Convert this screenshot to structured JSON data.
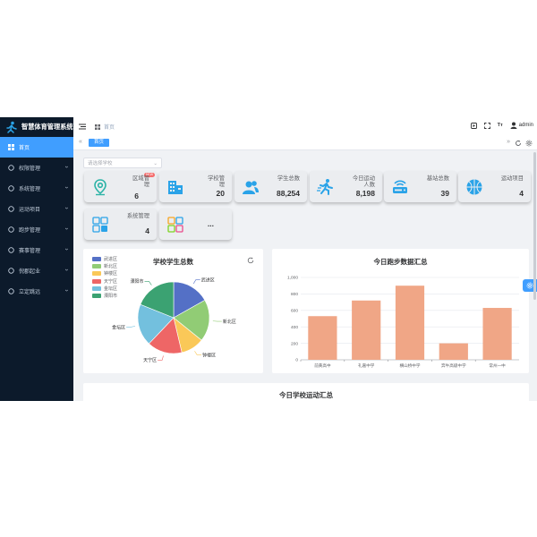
{
  "app_title": "智慧体育管理系统",
  "sidebar": {
    "items": [
      {
        "label": "首页",
        "icon": "grid-icon",
        "active": true
      },
      {
        "label": "权限管理",
        "icon": "shield-icon"
      },
      {
        "label": "系统管理",
        "icon": "settings-icon"
      },
      {
        "label": "运动项目",
        "icon": "ball-icon"
      },
      {
        "label": "跑步管理",
        "icon": "run-icon"
      },
      {
        "label": "赛事管理",
        "icon": "trophy-icon"
      },
      {
        "label": "倪郡起业",
        "icon": "flag-icon"
      },
      {
        "label": "立定跳远",
        "icon": "jump-icon"
      }
    ]
  },
  "topbar": {
    "breadcrumb": "首页",
    "user": "admin",
    "font_icon_label": "Tт"
  },
  "tags": {
    "active": "首页"
  },
  "filter": {
    "placeholder": "请选择学校"
  },
  "stats": [
    {
      "label": "区域管理",
      "value": "6",
      "icon": "location-icon",
      "badge": "NEW"
    },
    {
      "label": "学校管理",
      "value": "20",
      "icon": "building-icon"
    },
    {
      "label": "学生总数",
      "value": "88,254",
      "icon": "users-icon"
    },
    {
      "label": "今日运动人数",
      "value": "8,198",
      "icon": "runner-icon"
    },
    {
      "label": "基站总数",
      "value": "39",
      "icon": "router-icon"
    },
    {
      "label": "运动项目",
      "value": "4",
      "icon": "basketball-icon"
    },
    {
      "label": "系统管理",
      "value": "4",
      "icon": "system-icon"
    },
    {
      "label": "...",
      "value": "",
      "icon": "apps-icon"
    }
  ],
  "pie_panel": {
    "title": "学校学生总数"
  },
  "bar_panel": {
    "title": "今日跑步数据汇总"
  },
  "bottom_panel": {
    "title": "今日学校运动汇总"
  },
  "colors": {
    "accent": "#409eff",
    "sidebar": "#0c1a2b",
    "bar": "#f0a686",
    "icon": "#2aa3e8"
  },
  "chart_data": [
    {
      "type": "pie",
      "title": "学校学生总数",
      "legend_position": "left",
      "labels": [
        "武进区",
        "新北区",
        "钟楼区",
        "天宁区",
        "金坛区",
        "溧阳市"
      ],
      "values": [
        16,
        18,
        10,
        15,
        18,
        18
      ],
      "colors": [
        "#5470c6",
        "#91cc75",
        "#fac858",
        "#ee6666",
        "#73c0de",
        "#3ba272"
      ]
    },
    {
      "type": "bar",
      "title": "今日跑步数据汇总",
      "categories": [
        "前黄高中",
        "礼嘉中学",
        "横山桥中学",
        "奔牛高级中学",
        "常州一中"
      ],
      "values": [
        530,
        720,
        900,
        200,
        630
      ],
      "ylim": [
        0,
        1000
      ],
      "yticks": [
        "0",
        "200",
        "400",
        "600",
        "800",
        "1,000"
      ],
      "grid": true,
      "color": "#f0a686"
    }
  ]
}
